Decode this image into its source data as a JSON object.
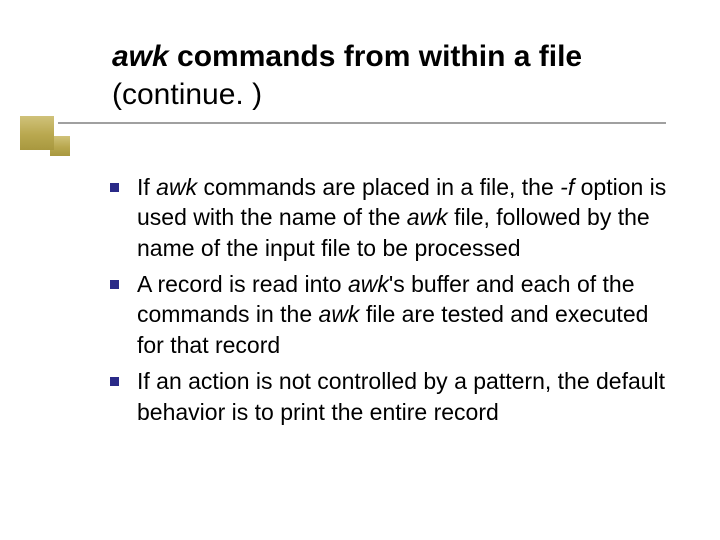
{
  "title": {
    "seg1_italic": "awk ",
    "seg2_bold": "commands from within a file ",
    "seg3_plain": "(continue. )"
  },
  "bullets": [
    {
      "p1": "If ",
      "p2_italic": "awk",
      "p3": " commands are placed in a file, the ",
      "p4_italic": "-f",
      "p5": " option is used with the name of the ",
      "p6_italic": "awk",
      "p7": " file, followed by the name of the input file to be processed"
    },
    {
      "p1": "A record is read into ",
      "p2_italic": "awk",
      "p3": "'s buffer and each of the commands in the ",
      "p4_italic": "awk",
      "p5": " file are tested and executed for that record"
    },
    {
      "p1": "If an action is not controlled by a pattern, the default behavior is to print the entire record"
    }
  ]
}
